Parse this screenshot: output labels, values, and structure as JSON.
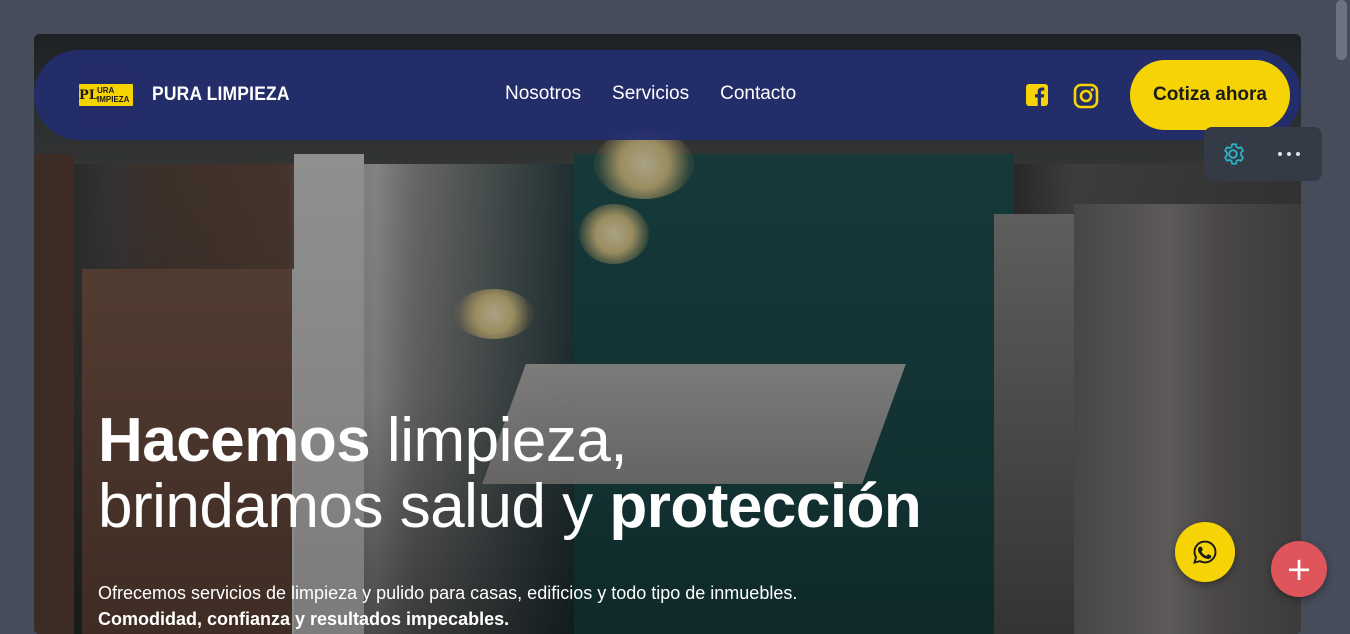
{
  "brand": {
    "logo_letters": "PL",
    "logo_words": [
      "URA",
      "IMPIEZA"
    ],
    "name": "PURA LIMPIEZA"
  },
  "nav": {
    "items": [
      {
        "label": "Nosotros"
      },
      {
        "label": "Servicios"
      },
      {
        "label": "Contacto"
      }
    ],
    "cta_label": "Cotiza ahora"
  },
  "social": {
    "facebook_icon": "facebook-icon",
    "instagram_icon": "instagram-icon"
  },
  "hero": {
    "title_line1_bold": "Hacemos",
    "title_line1_light": " limpieza,",
    "title_line2_light": "brindamos salud y ",
    "title_line2_bold": "protección",
    "subtitle": "Ofrecemos servicios de limpieza y pulido para casas, edificios y todo tipo de inmuebles.",
    "subtitle_strong": "Comodidad, confianza y resultados impecables."
  },
  "colors": {
    "nav_bg": "#232d6e",
    "accent_yellow": "#f6d305",
    "plus_red": "#e0545b",
    "page_bg": "#464c5a"
  },
  "floating": {
    "plus_label": "+",
    "whatsapp_icon": "whatsapp-icon",
    "settings_icon": "gear-icon",
    "more_icon": "more-dots-icon"
  }
}
